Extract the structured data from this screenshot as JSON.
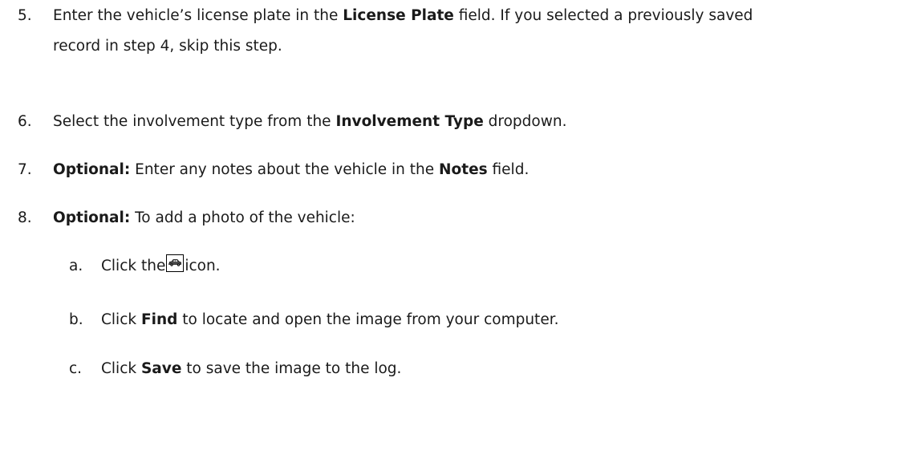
{
  "steps": [
    {
      "num": "5.",
      "parts": [
        "Enter the vehicle’s license plate in the ",
        "License Plate",
        " field. If you selected a previously saved"
      ],
      "continuation": "record in step 4, skip this step."
    },
    {
      "num": "6.",
      "parts": [
        "Select the involvement type from the ",
        "Involvement Type",
        " dropdown."
      ]
    },
    {
      "num": "7.",
      "parts": [
        "Optional:",
        " Enter any notes about the vehicle in the ",
        "Notes",
        " field."
      ]
    },
    {
      "num": "8.",
      "parts": [
        "Optional:",
        " To add a photo of the vehicle:"
      ]
    }
  ],
  "substeps": [
    {
      "num": "a.",
      "parts": [
        "Click the",
        "icon."
      ],
      "icon": "car-icon"
    },
    {
      "num": "b.",
      "parts": [
        "Click ",
        "Find",
        " to locate and open the image from your computer."
      ]
    },
    {
      "num": "c.",
      "parts": [
        "Click ",
        "Save",
        " to save the image to the log."
      ]
    }
  ]
}
